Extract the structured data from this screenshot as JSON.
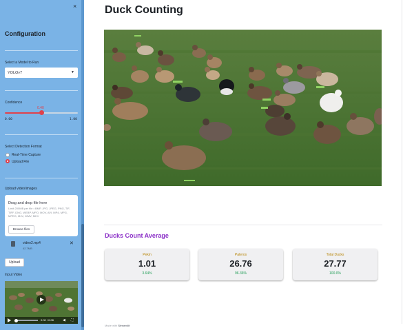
{
  "sidebar": {
    "close_label": "×",
    "title": "Configuration",
    "model_label": "Select a Model to Run",
    "model_value": "YOLOv7",
    "confidence_label": "Confidence",
    "confidence_value": "0.40",
    "confidence_fraction": 0.5,
    "confidence_min": "0.00",
    "confidence_max": "1.00",
    "detection_label": "Select Detection Format",
    "detection_options": [
      "Real-Time Capture",
      "Upload File"
    ],
    "detection_selected": "Upload File",
    "upload_label": "Upload video/images",
    "dropzone_title": "Drag and drop file here",
    "dropzone_limits": "Limit 200MB per file • BMP, JPG, JPEG, PNG, TIF, TIFF, DNG, WEBP, MPO, MOV, AVI, MP4, MPG, MPEG, M4V, WMV, MKV",
    "browse_label": "Browse files",
    "file_name": "video2.mp4",
    "file_size": "42.7MB",
    "remove_label": "✕",
    "upload_button": "Upload",
    "input_video_label": "Input Video",
    "video_time": "0:00 / 0:08"
  },
  "main": {
    "title": "Duck Counting",
    "section_title": "Ducks Count Average",
    "footer_prefix": "Made with",
    "footer_brand": "Streamlit"
  },
  "cards": [
    {
      "label": "Pekin",
      "value": "1.01",
      "pct": "3.64%"
    },
    {
      "label": "Pateros",
      "value": "26.76",
      "pct": "96.36%"
    },
    {
      "label": "Total Ducks",
      "value": "27.77",
      "pct": "100.0%"
    }
  ],
  "colors": {
    "accent": "#e0414b",
    "sidebar": "#7ab3e6",
    "section_title": "#8a2ec7",
    "card_label": "#b8860b",
    "card_pct": "#1f9d55"
  },
  "icons": [
    "close-icon",
    "chevron-down-icon",
    "file-icon",
    "play-icon",
    "volume-icon",
    "fullscreen-icon"
  ]
}
